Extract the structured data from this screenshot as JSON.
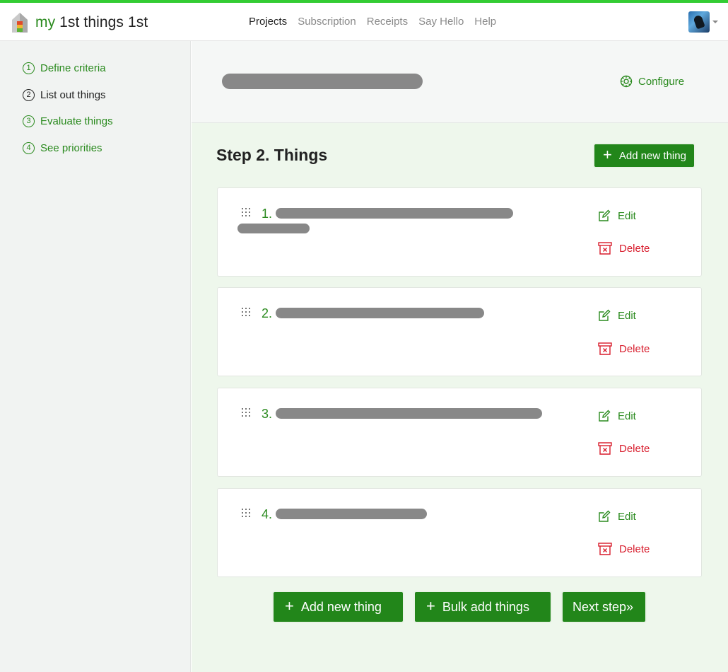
{
  "brand": {
    "prefix": "my",
    "rest": " 1st things 1st"
  },
  "nav": {
    "links": [
      {
        "label": "Projects",
        "active": true
      },
      {
        "label": "Subscription",
        "active": false
      },
      {
        "label": "Receipts",
        "active": false
      },
      {
        "label": "Say Hello",
        "active": false
      },
      {
        "label": "Help",
        "active": false
      }
    ]
  },
  "sidebar": {
    "steps": [
      {
        "num": "1",
        "label": "Define criteria",
        "state": "link"
      },
      {
        "num": "2",
        "label": "List out things",
        "state": "current"
      },
      {
        "num": "3",
        "label": "Evaluate things",
        "state": "link"
      },
      {
        "num": "4",
        "label": "See priorities",
        "state": "link"
      }
    ]
  },
  "project": {
    "configure_label": "Configure"
  },
  "step": {
    "title": "Step 2. Things",
    "add_label": "Add new thing"
  },
  "things": [
    {
      "num": "1.",
      "edit_label": "Edit",
      "delete_label": "Delete"
    },
    {
      "num": "2.",
      "edit_label": "Edit",
      "delete_label": "Delete"
    },
    {
      "num": "3.",
      "edit_label": "Edit",
      "delete_label": "Delete"
    },
    {
      "num": "4.",
      "edit_label": "Edit",
      "delete_label": "Delete"
    }
  ],
  "footer_buttons": {
    "add_label": "Add new thing",
    "bulk_label": "Bulk add things",
    "next_label": "Next step»"
  },
  "colors": {
    "accent_green": "#2a8a1e",
    "button_green": "#22861a",
    "delete_red": "#d81c2c",
    "topline": "#33cc33",
    "main_bg": "#eef7ec",
    "sidebar_bg": "#f1f3f2"
  },
  "icons": {
    "configure": "settings-icon",
    "edit": "edit-icon",
    "delete": "delete-icon",
    "drag": "drag-handle-icon",
    "add": "plus-icon"
  }
}
